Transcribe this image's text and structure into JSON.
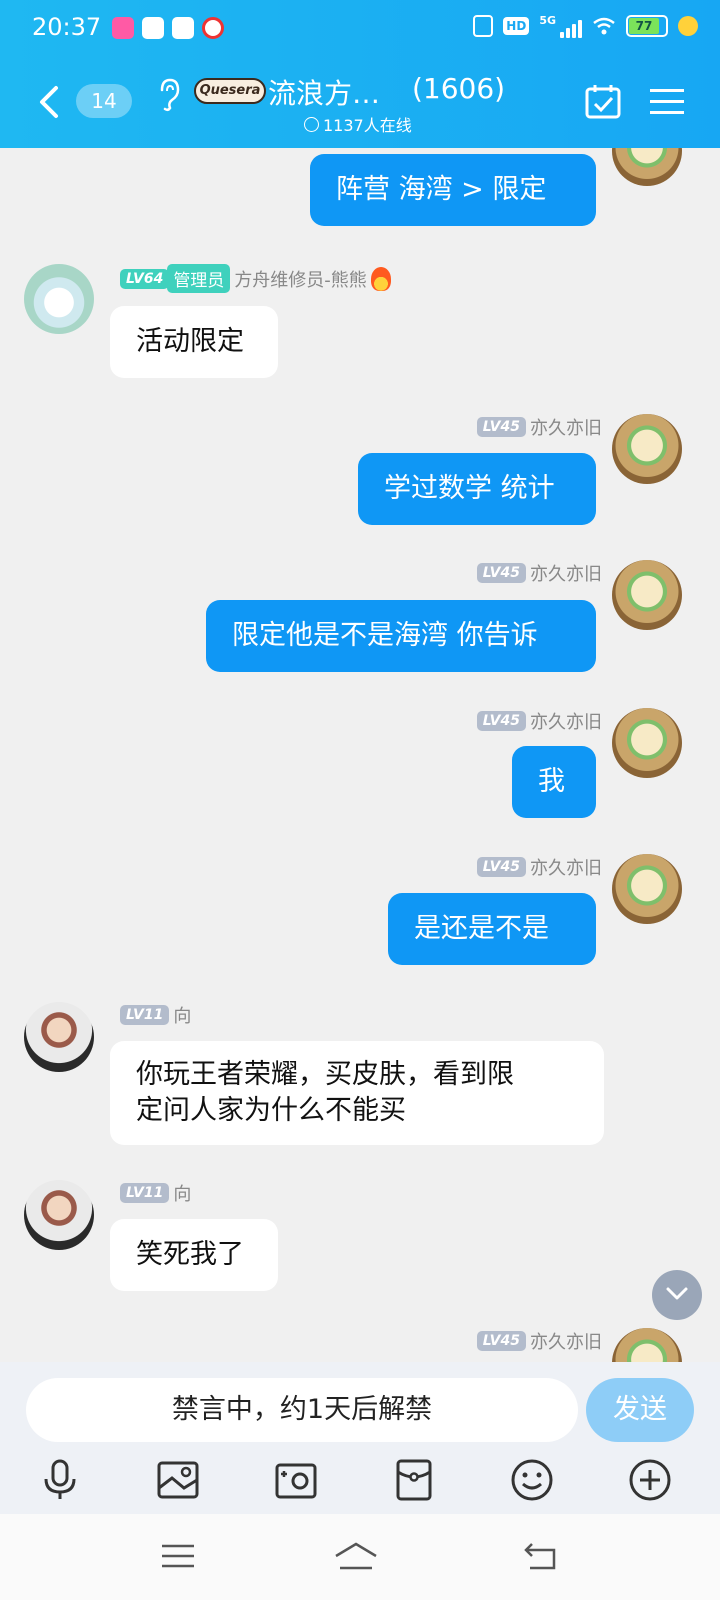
{
  "status_bar": {
    "time": "20:37",
    "network": "5G",
    "hd": "HD",
    "battery": "77"
  },
  "header": {
    "unread_count": "14",
    "logo_text": "Quesera",
    "group_name": "流浪方…",
    "member_count": "(1606)",
    "online_text": "1137人在线"
  },
  "messages": [
    {
      "side": "out",
      "text": "阵营  海湾 > 限定"
    },
    {
      "side": "in",
      "level": "LV64",
      "role": "管理员",
      "sender": "方舟维修员-熊熊",
      "text": "活动限定"
    },
    {
      "side": "out",
      "level": "LV45",
      "sender": "亦久亦旧",
      "text": "学过数学 统计"
    },
    {
      "side": "out",
      "level": "LV45",
      "sender": "亦久亦旧",
      "text": "限定他是不是海湾 你告诉"
    },
    {
      "side": "out",
      "level": "LV45",
      "sender": "亦久亦旧",
      "text": "我"
    },
    {
      "side": "out",
      "level": "LV45",
      "sender": "亦久亦旧",
      "text": "是还是不是"
    },
    {
      "side": "in",
      "level": "LV11",
      "sender": "向",
      "text_line1": "你玩王者荣耀，买皮肤，看到限",
      "text_line2": "定问人家为什么不能买"
    },
    {
      "side": "in",
      "level": "LV11",
      "sender": "向",
      "text": "笑死我了"
    },
    {
      "side": "out",
      "level": "LV45",
      "sender": "亦久亦旧"
    }
  ],
  "input": {
    "muted_text": "禁言中，约1天后解禁",
    "send_label": "发送"
  },
  "icons": {
    "toolbar": [
      "microphone-icon",
      "image-icon",
      "camera-icon",
      "red-packet-icon",
      "emoji-icon",
      "plus-icon"
    ],
    "nav": [
      "menu-icon",
      "home-icon",
      "back-icon"
    ]
  },
  "colors": {
    "header": "#17a7f3",
    "outgoing_bubble": "#0f97f5",
    "admin_badge": "#3fd1bd",
    "send_button": "#8ecdf7"
  }
}
